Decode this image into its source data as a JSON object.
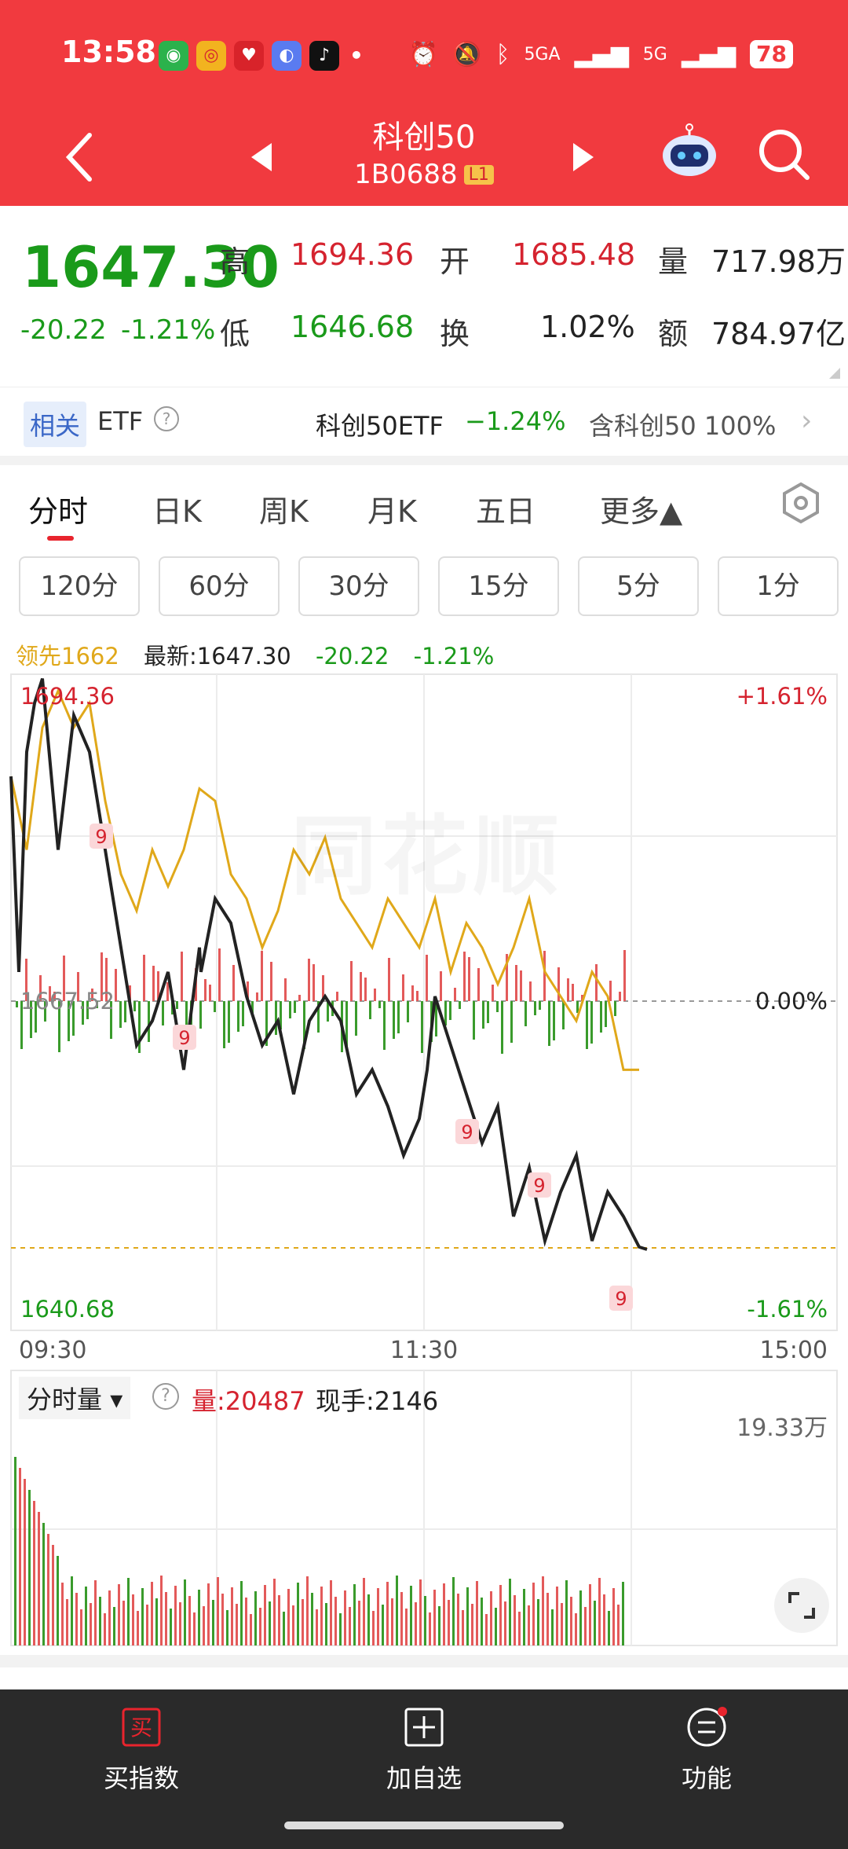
{
  "status_bar": {
    "time": "13:58",
    "battery": "78",
    "network_1": "5GA",
    "network_2": "5G"
  },
  "header": {
    "title": "科创50",
    "code": "1B0688",
    "level": "L1"
  },
  "quote": {
    "price": "1647.30",
    "change": "-20.22",
    "change_pct": "-1.21%",
    "high_label": "高",
    "high": "1694.36",
    "open_label": "开",
    "open": "1685.48",
    "volume_label": "量",
    "volume": "717.98万",
    "low_label": "低",
    "low": "1646.68",
    "turnover_label": "换",
    "turnover": "1.02%",
    "amount_label": "额",
    "amount": "784.97亿"
  },
  "etf": {
    "tag": "相关",
    "label": "ETF",
    "help": "?",
    "name": "科创50ETF",
    "change": "−1.24%",
    "contain": "含科创50 100%"
  },
  "tabs": [
    {
      "label": "分时",
      "active": true
    },
    {
      "label": "日K"
    },
    {
      "label": "周K"
    },
    {
      "label": "月K"
    },
    {
      "label": "五日"
    },
    {
      "label": "更多▲"
    }
  ],
  "periods": [
    "120分",
    "60分",
    "30分",
    "15分",
    "5分",
    "1分"
  ],
  "legend": {
    "lead": "领先1662",
    "latest": "最新:1647.30",
    "change": "-20.22",
    "pct": "-1.21%"
  },
  "chart": {
    "y_top": "1694.36",
    "y_mid": "1667.52",
    "y_bottom": "1640.68",
    "pct_top": "+1.61%",
    "pct_mid": "0.00%",
    "pct_bottom": "-1.61%",
    "times": [
      "09:30",
      "11:30",
      "15:00"
    ],
    "watermark": "同花顺",
    "markers": [
      "9",
      "9",
      "9",
      "9",
      "9"
    ]
  },
  "volume": {
    "label": "分时量",
    "amount": "量:20487",
    "hand": "现手:2146",
    "max": "19.33万"
  },
  "nav": [
    {
      "label": "买指数",
      "icon_text": "买"
    },
    {
      "label": "加自选"
    },
    {
      "label": "功能"
    }
  ],
  "colors": {
    "header": "#f13a3f",
    "up": "#d5232f",
    "down": "#1a9a1a",
    "lead_line": "#e0a81a"
  },
  "chart_data": {
    "type": "line",
    "ylim": [
      1640.68,
      1694.36
    ],
    "series": [
      {
        "name": "最新",
        "x": [
          0,
          10,
          20,
          30,
          40,
          60,
          80,
          100,
          120,
          140,
          160,
          180,
          200,
          220,
          240,
          242,
          260,
          280,
          300,
          320,
          340,
          360,
          380,
          400,
          420,
          440,
          460,
          480,
          500,
          520,
          530,
          540,
          560,
          580,
          600,
          620,
          640,
          660,
          680,
          700,
          720,
          740,
          760,
          780,
          800,
          810
        ],
        "y": [
          1686,
          1670,
          1688,
          1692,
          1694,
          1680,
          1691,
          1688,
          1680,
          1672,
          1664,
          1666,
          1670,
          1662,
          1672,
          1670,
          1676,
          1674,
          1668,
          1664,
          1666,
          1660,
          1666,
          1668,
          1666,
          1660,
          1662,
          1659,
          1655,
          1658,
          1662,
          1668,
          1664,
          1660,
          1656,
          1659,
          1650,
          1654,
          1648,
          1652,
          1655,
          1648,
          1652,
          1650,
          1647.5,
          1647.3
        ]
      },
      {
        "name": "领先",
        "x": [
          0,
          20,
          40,
          60,
          80,
          100,
          120,
          140,
          160,
          180,
          200,
          220,
          240,
          260,
          280,
          300,
          320,
          340,
          360,
          380,
          400,
          420,
          440,
          460,
          480,
          500,
          520,
          540,
          560,
          580,
          600,
          620,
          640,
          660,
          680,
          700,
          720,
          740,
          760,
          780,
          800
        ],
        "y": [
          1686,
          1680,
          1690,
          1693,
          1690,
          1692,
          1684,
          1678,
          1675,
          1680,
          1677,
          1680,
          1685,
          1684,
          1678,
          1676,
          1672,
          1675,
          1680,
          1678,
          1681,
          1676,
          1674,
          1672,
          1676,
          1674,
          1672,
          1676,
          1670,
          1674,
          1672,
          1669,
          1672,
          1676,
          1670,
          1668,
          1666,
          1670,
          1668,
          1662,
          1662
        ]
      }
    ]
  }
}
